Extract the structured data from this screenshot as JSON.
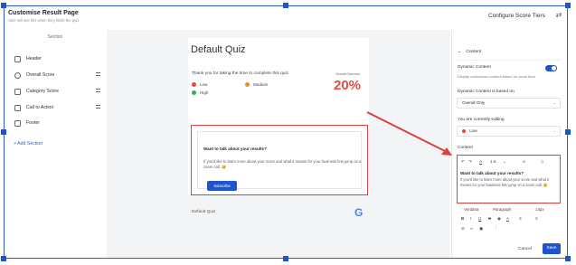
{
  "header": {
    "title": "Customise Result Page",
    "subtitle": "User will see this when they finish the quiz",
    "tiers_link": "Configure Score Tiers"
  },
  "sidebar": {
    "section_header": "Section",
    "items": [
      {
        "label": "Header"
      },
      {
        "label": "Overall Score"
      },
      {
        "label": "Category Score"
      },
      {
        "label": "Call to Action"
      },
      {
        "label": "Footer"
      }
    ],
    "add_section": "+ Add Section"
  },
  "preview": {
    "quiz_title": "Default Quiz",
    "thanks_text": "Thank you for taking the time to complete this quiz.",
    "outcome_label": "Overall Outcome",
    "outcome_value": "20%",
    "legend": [
      {
        "label": "Low",
        "color": "#e8453c"
      },
      {
        "label": "Medium",
        "color": "#f08c2a"
      },
      {
        "label": "High",
        "color": "#2fae63"
      }
    ],
    "cta": {
      "heading": "Want to talk about your results?",
      "body": "If you'd like to learn more about your score and what it means for your business lets jump on a zoom call. 😊",
      "button": "Subscribe"
    },
    "footer_text": "Default Quiz",
    "footer_logo": "G"
  },
  "panel": {
    "collapse_label": "Content",
    "dynamic_label": "Dynamic Content",
    "dynamic_desc": "Display customized content based on score tiers",
    "dynamic_on": true,
    "based_on_label": "Dynamic Content is based on",
    "based_on_value": "Overall Only",
    "editing_label": "You are currently editing",
    "editing_value": "Low",
    "editing_color": "#e8453c",
    "content_label": "Content",
    "editor": {
      "heading": "Want to talk about your results?",
      "body": "If you'd like to learn more about your score and what it means for your business lets jump on a zoom call. 😊",
      "line_height": "1.5"
    },
    "font": "Verdana",
    "paragraph": "Paragraph",
    "font_size": "14px",
    "cancel_label": "Cancel",
    "save_label": "Save"
  },
  "colors": {
    "accent": "#1f54d0",
    "highlight": "#d94140"
  }
}
